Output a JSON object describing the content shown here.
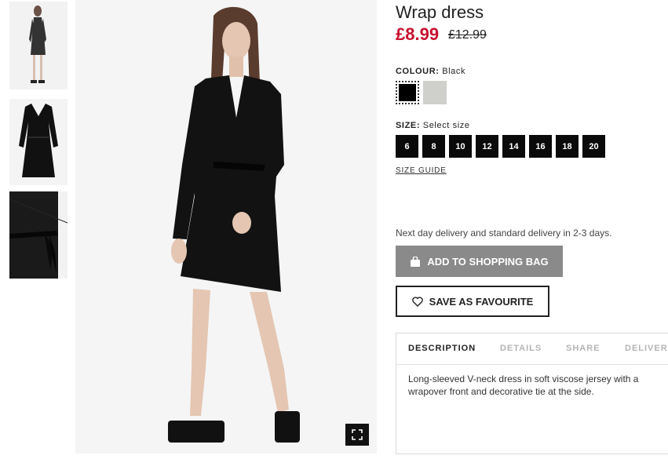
{
  "product": {
    "title": "Wrap dress",
    "price": "£8.99",
    "old_price": "£12.99"
  },
  "colour": {
    "label": "COLOUR:",
    "selected": "Black",
    "swatches": [
      {
        "name": "Black",
        "hex": "#000000"
      },
      {
        "name": "Light grey",
        "hex": "#cfcfcc"
      }
    ]
  },
  "size": {
    "label": "SIZE:",
    "placeholder": "Select size",
    "options": [
      "6",
      "8",
      "10",
      "12",
      "14",
      "16",
      "18",
      "20"
    ],
    "guide_label": "SIZE GUIDE"
  },
  "delivery_text": "Next day delivery and standard delivery in 2-3 days.",
  "buttons": {
    "add_to_bag": "ADD TO SHOPPING BAG",
    "save_favourite": "SAVE AS FAVOURITE",
    "add_icon": "shopping-bag-icon",
    "fav_icon": "heart-icon",
    "expand_icon": "expand-icon"
  },
  "tabs": [
    {
      "label": "DESCRIPTION",
      "active": true
    },
    {
      "label": "DETAILS",
      "active": false
    },
    {
      "label": "SHARE",
      "active": false
    },
    {
      "label": "DELIVERY",
      "active": false
    }
  ],
  "description": "Long-sleeved V-neck dress in soft viscose jersey with a wrapover front and decorative tie at the side.",
  "colors": {
    "price_red": "#c8102e",
    "button_grey": "#8a8a8a",
    "size_bg": "#0a0a0a"
  }
}
